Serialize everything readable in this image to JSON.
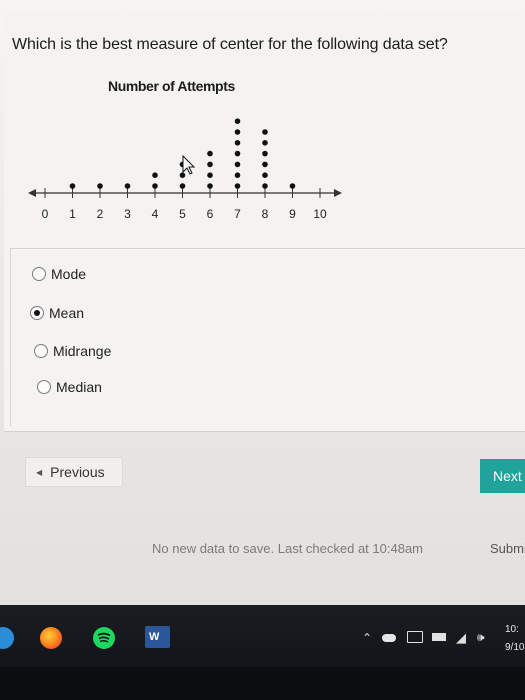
{
  "question": {
    "text": "Which is the best measure of center for the following data set?"
  },
  "chart_data": {
    "type": "scatter",
    "subtype": "dot-plot",
    "title": "Number of Attempts",
    "x_ticks": [
      0,
      1,
      2,
      3,
      4,
      5,
      6,
      7,
      8,
      9,
      10
    ],
    "xlim": [
      0,
      10
    ],
    "grid": false,
    "counts": [
      {
        "x": 0,
        "count": 0
      },
      {
        "x": 1,
        "count": 1
      },
      {
        "x": 2,
        "count": 1
      },
      {
        "x": 3,
        "count": 1
      },
      {
        "x": 4,
        "count": 2
      },
      {
        "x": 5,
        "count": 3
      },
      {
        "x": 6,
        "count": 4
      },
      {
        "x": 7,
        "count": 7
      },
      {
        "x": 8,
        "count": 6
      },
      {
        "x": 9,
        "count": 1
      },
      {
        "x": 10,
        "count": 0
      }
    ]
  },
  "choices": [
    {
      "label": "Mode",
      "selected": false
    },
    {
      "label": "Mean",
      "selected": true
    },
    {
      "label": "Midrange",
      "selected": false
    },
    {
      "label": "Median",
      "selected": false
    }
  ],
  "navigation": {
    "previous_label": "Previous",
    "next_label": "Next"
  },
  "footer": {
    "save_status": "No new data to save. Last checked at 10:48am",
    "submit_label": "Submit"
  },
  "taskbar": {
    "time": "10:",
    "date": "9/10",
    "apps": [
      "start-icon",
      "firefox-icon",
      "spotify-icon",
      "word-icon"
    ]
  }
}
